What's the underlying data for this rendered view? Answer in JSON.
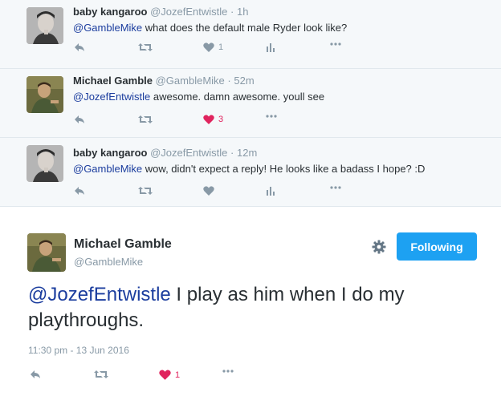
{
  "replies": [
    {
      "name": "baby kangaroo",
      "handle": "@JozefEntwistle",
      "dot": "·",
      "time": "1h",
      "mention": "@GambleMike",
      "text": " what does the default male Ryder look like?",
      "like_count": "1",
      "liked": false
    },
    {
      "name": "Michael Gamble",
      "handle": "@GambleMike",
      "dot": "·",
      "time": "52m",
      "mention": "@JozefEntwistle",
      "text": " awesome. damn awesome. youll see",
      "like_count": "3",
      "liked": true
    },
    {
      "name": "baby kangaroo",
      "handle": "@JozefEntwistle",
      "dot": "·",
      "time": "12m",
      "mention": "@GambleMike",
      "text": " wow, didn't expect a reply! He looks like a badass I hope? :D",
      "like_count": "",
      "liked": false
    }
  ],
  "main": {
    "name": "Michael Gamble",
    "handle": "@GambleMike",
    "follow_label": "Following",
    "mention": "@JozefEntwistle",
    "text": " I play as him when I do my playthroughs.",
    "timestamp": "11:30 pm - 13 Jun 2016",
    "like_count": "1",
    "liked": true
  },
  "colors": {
    "accent": "#1da1f2",
    "mention": "#1b3d9e",
    "like": "#e0245e",
    "muted": "#8899a6",
    "thread_bg": "#f5f8fa"
  },
  "icons": [
    "reply-icon",
    "retweet-icon",
    "heart-icon",
    "analytics-icon",
    "more-icon",
    "gear-icon"
  ]
}
